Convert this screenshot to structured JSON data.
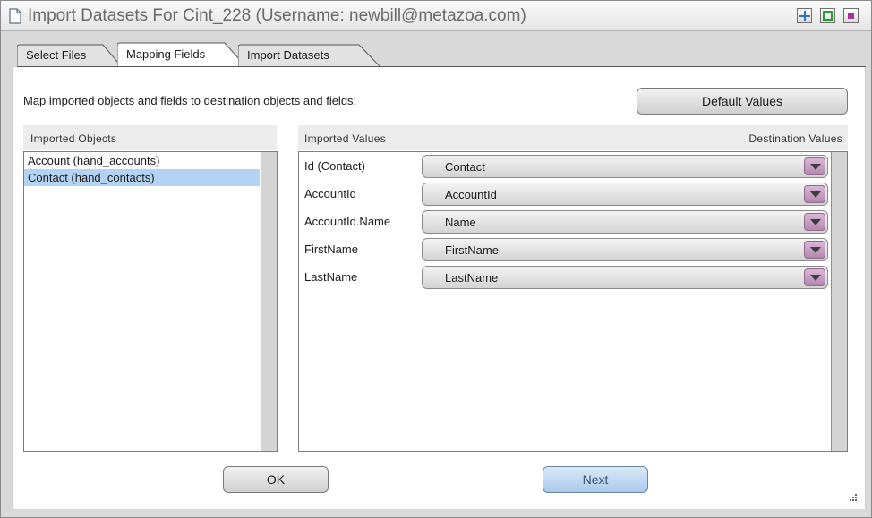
{
  "window": {
    "title": "Import Datasets For Cint_228 (Username: newbill@metazoa.com)"
  },
  "tabs": [
    {
      "label": "Select Files",
      "active": false
    },
    {
      "label": "Mapping Fields",
      "active": true
    },
    {
      "label": "Import Datasets",
      "active": false
    }
  ],
  "instructions": "Map imported objects and fields to destination objects and fields:",
  "buttons": {
    "default_values": "Default Values",
    "ok": "OK",
    "next": "Next"
  },
  "imported_objects": {
    "header": "Imported Objects",
    "items": [
      {
        "label": "Account (hand_accounts)",
        "selected": false
      },
      {
        "label": "Contact (hand_contacts)",
        "selected": true
      }
    ]
  },
  "mapping": {
    "header_left": "Imported Values",
    "header_right": "Destination Values",
    "rows": [
      {
        "source": "Id (Contact)",
        "destination": "Contact"
      },
      {
        "source": "AccountId",
        "destination": "AccountId"
      },
      {
        "source": "AccountId.Name",
        "destination": "Name"
      },
      {
        "source": "FirstName",
        "destination": "FirstName"
      },
      {
        "source": "LastName",
        "destination": "LastName"
      }
    ]
  },
  "colors": {
    "selected_row": "#b3d3f5",
    "dropdown_arrow": "#c49bc0",
    "primary_button": "#a9c9ec",
    "window_controls": [
      "#3a7bd5",
      "#2faa3a",
      "#b03fa5"
    ]
  },
  "icons": [
    "document-icon",
    "maximize-icon",
    "minimize-icon",
    "close-icon",
    "chevron-down-icon",
    "resize-grip-icon"
  ]
}
